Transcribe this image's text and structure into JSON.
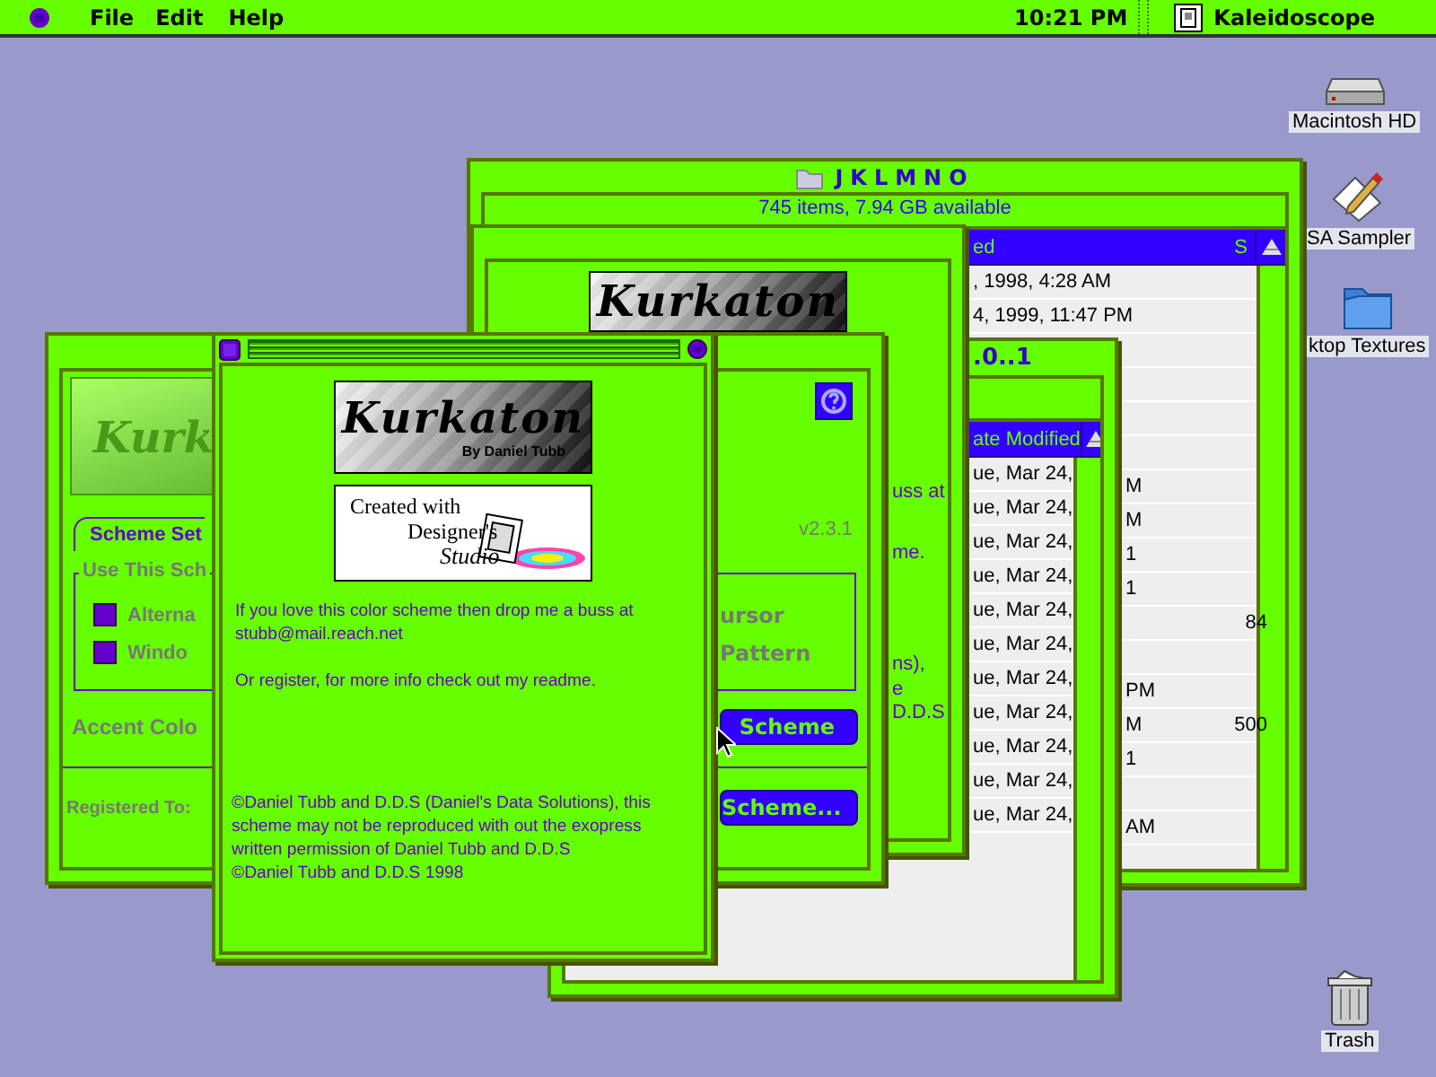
{
  "menu_bar": {
    "menus": [
      {
        "label": "File"
      },
      {
        "label": "Edit"
      },
      {
        "label": "Help"
      }
    ],
    "clock": "10:21 PM",
    "app": "Kaleidoscope"
  },
  "desktop_icons": [
    {
      "kind": "disk",
      "label": "Macintosh HD"
    },
    {
      "kind": "document",
      "label": "SA Sampler"
    },
    {
      "kind": "folder",
      "label": "ktop Textures"
    },
    {
      "kind": "trash",
      "label": "Trash"
    }
  ],
  "finder_window": {
    "title": "JKLMNO",
    "info": "745 items, 7.94 GB available",
    "columns": [
      {
        "label": "ed"
      },
      {
        "label": "S"
      }
    ],
    "rows": [
      {
        "modified": ", 1998, 4:28 AM"
      },
      {
        "modified": "4, 1999, 11:47 PM"
      },
      {},
      {},
      {},
      {},
      {
        "modified": "M"
      },
      {
        "modified": "M"
      },
      {
        "modified": "1"
      },
      {
        "modified": "1"
      },
      {
        "size": "84"
      },
      {},
      {
        "modified": "PM"
      },
      {
        "modified": "M",
        "size": "500"
      },
      {
        "modified": "1"
      },
      {},
      {
        "modified": "AM"
      }
    ]
  },
  "list_window": {
    "title": ".0..1",
    "column": "ate Modified",
    "rows": [
      {
        "modified": "ue, Mar 24,"
      },
      {
        "modified": "ue, Mar 24,"
      },
      {
        "modified": "ue, Mar 24,"
      },
      {
        "modified": "ue, Mar 24,"
      },
      {
        "modified": "ue, Mar 24,"
      },
      {
        "modified": "ue, Mar 24,"
      },
      {
        "modified": "ue, Mar 24,"
      },
      {
        "modified": "ue, Mar 24,"
      },
      {
        "modified": "ue, Mar 24,"
      },
      {
        "modified": "ue, Mar 24,"
      },
      {
        "modified": "ue, Mar 24,"
      }
    ]
  },
  "about_window_back": {
    "logo_title": "Kurkaton",
    "fragments": [
      "uss at",
      "me.",
      "ns),",
      "e",
      "D.D.S"
    ]
  },
  "settings_window": {
    "logo_text": "Kurk",
    "tab": "Scheme Set",
    "group_label": "Use This Sch",
    "options": [
      {
        "label": "Alterna",
        "checked": false
      },
      {
        "label": "Windo",
        "checked": false
      }
    ],
    "right_options": [
      "ursor",
      "Pattern"
    ],
    "version": "v2.3.1",
    "accent_label": "Accent Colo",
    "registered_label": "Registered To:",
    "buttons": [
      "Scheme",
      "Scheme..."
    ]
  },
  "about_window": {
    "logo_title": "Kurkaton",
    "logo_byline": "By Daniel Tubb",
    "badge_lines": [
      "Created with",
      "Designer's",
      "Studio"
    ],
    "message": "If you love this color scheme then drop me a buss at stubb@mail.reach.net",
    "register_note": "Or register, for more info check out my readme.",
    "copyright": "©Daniel Tubb and D.D.S (Daniel's Data Solutions), this scheme may not be reproduced with out the exopress written permission of Daniel Tubb and D.D.S",
    "copyright_year": "©Daniel Tubb and D.D.S 1998"
  }
}
